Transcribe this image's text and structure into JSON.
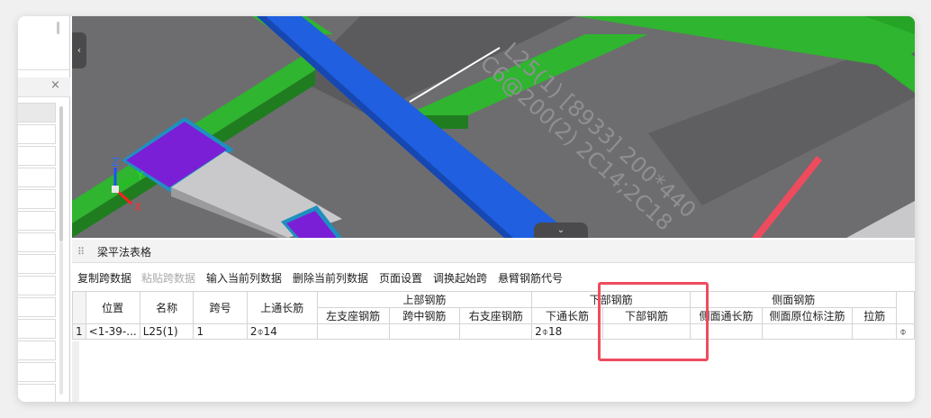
{
  "viewport": {
    "annotation_line1": "L25(1) [8933] 200*440",
    "annotation_line2": "C6@200(2) 2C14;2C18",
    "axis_x": "X",
    "axis_y": "Y",
    "axis_z": "Z"
  },
  "controls": {
    "collapse_left_glyph": "‹",
    "collapse_bottom_glyph": "⌄",
    "drag_handle_glyph": "⠿",
    "close_glyph": "×"
  },
  "panel": {
    "title": "梁平法表格"
  },
  "toolbar": {
    "copy_span": "复制跨数据",
    "paste_span": "粘贴跨数据",
    "input_current_column": "输入当前列数据",
    "delete_current_column": "删除当前列数据",
    "page_setup": "页面设置",
    "swap_start_span": "调换起始跨",
    "cantilever_code": "悬臂钢筋代号"
  },
  "table": {
    "group_headers": {
      "top": "上部钢筋",
      "bottom": "下部钢筋",
      "side": "侧面钢筋"
    },
    "headers": {
      "position": "位置",
      "name": "名称",
      "span_no": "跨号",
      "top_through": "上通长筋",
      "left_support": "左支座钢筋",
      "mid_span": "跨中钢筋",
      "right_support": "右支座钢筋",
      "bottom_through": "下通长筋",
      "bottom_rebar": "下部钢筋",
      "side_through": "侧面通长筋",
      "side_original": "侧面原位标注筋",
      "tie": "拉筋"
    },
    "row1": {
      "num": "1",
      "position": "<1-39-...",
      "name": "L25(1)",
      "span_no": "1",
      "top_through": "2⌽14",
      "left_support": "",
      "mid_span": "",
      "right_support": "",
      "bottom_through": "2⌽18",
      "bottom_rebar": "",
      "side_through": "",
      "side_original": "",
      "tie": "",
      "extra": "⌽"
    }
  },
  "colors": {
    "viewport_bg": "#6d6d70",
    "beam_green": "#2fb52f",
    "beam_blue": "#1f5fe0",
    "column_purple": "#7b1fd6",
    "highlight_red": "#ef4b5e"
  }
}
